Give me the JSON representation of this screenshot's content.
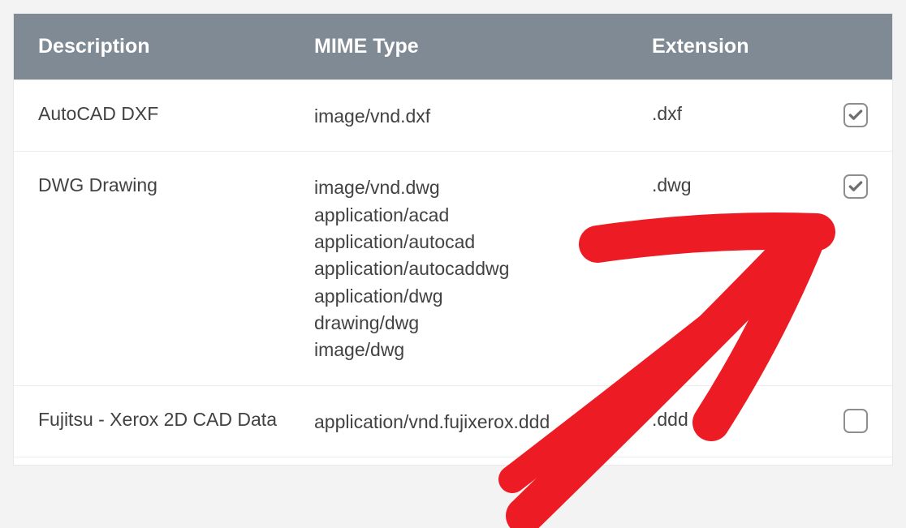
{
  "table": {
    "headers": {
      "description": "Description",
      "mime": "MIME Type",
      "extension": "Extension"
    },
    "rows": [
      {
        "description": "AutoCAD DXF",
        "mimes": [
          "image/vnd.dxf"
        ],
        "extension": ".dxf",
        "checked": true
      },
      {
        "description": "DWG Drawing",
        "mimes": [
          "image/vnd.dwg",
          "application/acad",
          "application/autocad",
          "application/autocaddwg",
          "application/dwg",
          "drawing/dwg",
          "image/dwg"
        ],
        "extension": ".dwg",
        "checked": true
      },
      {
        "description": "Fujitsu - Xerox 2D CAD Data",
        "mimes": [
          "application/vnd.fujixerox.ddd"
        ],
        "extension": ".ddd",
        "checked": false
      }
    ]
  },
  "annotation": {
    "color": "#ED1C24"
  }
}
